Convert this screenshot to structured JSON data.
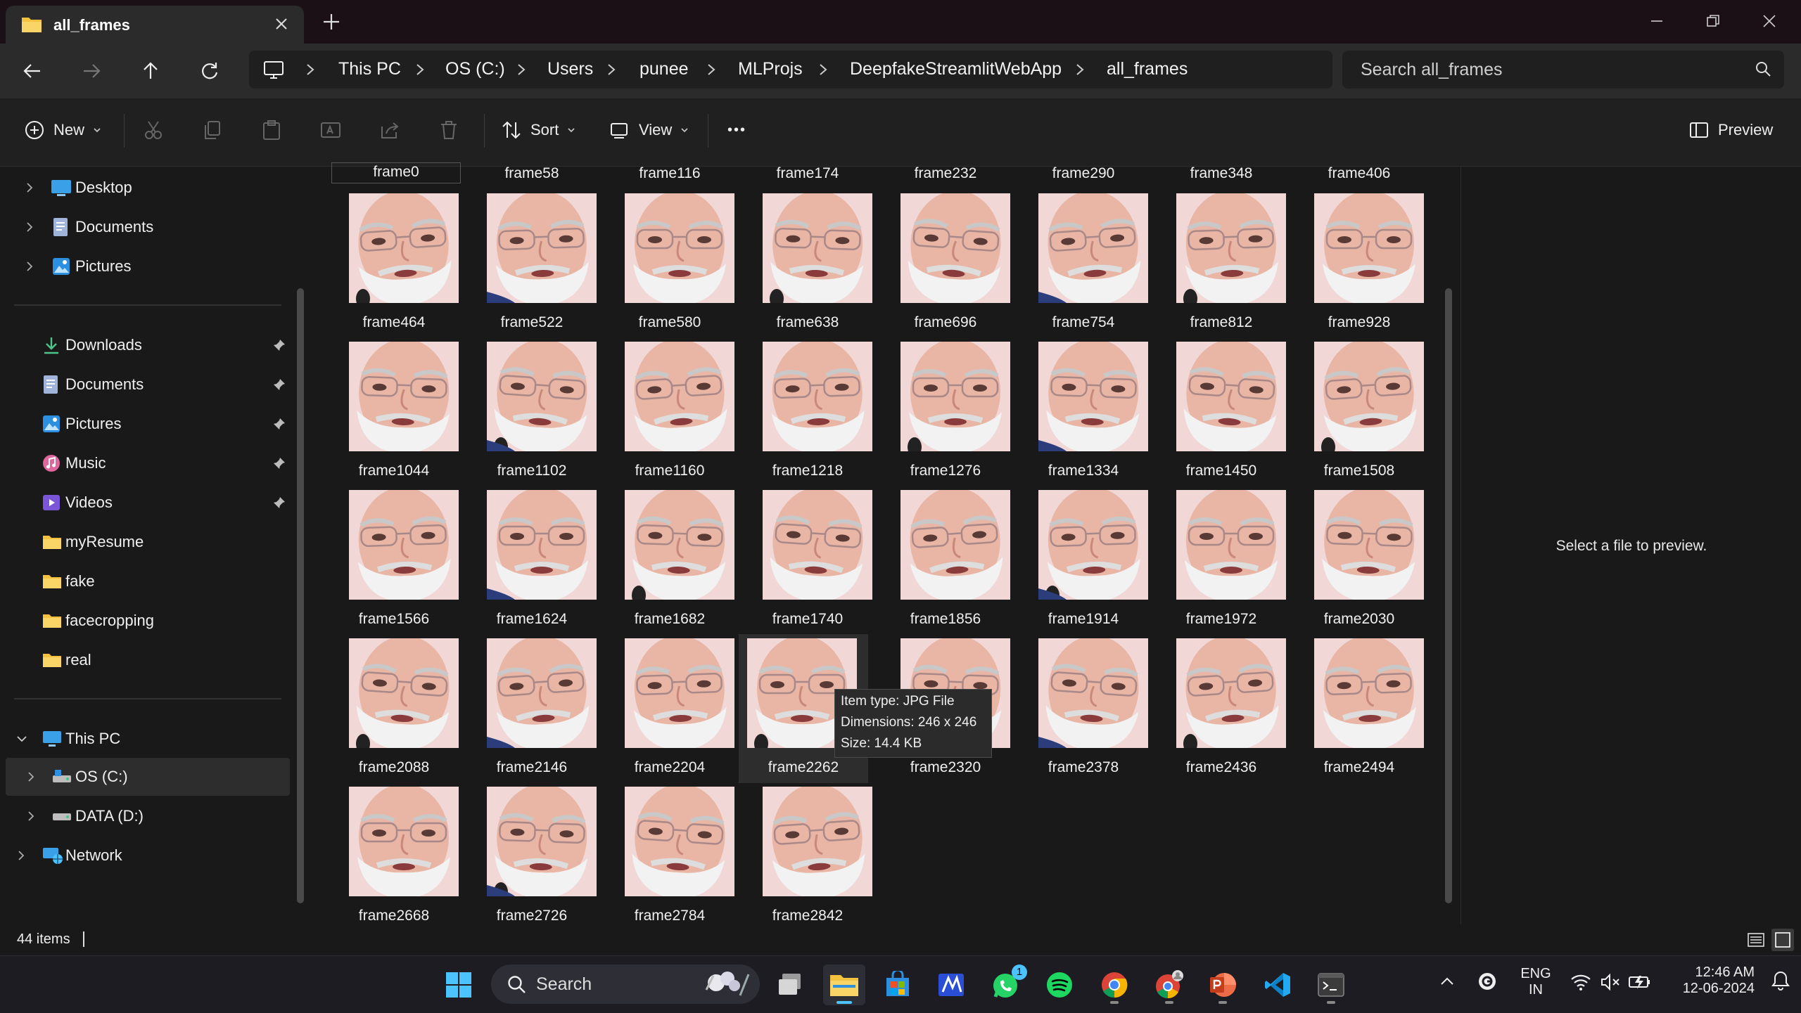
{
  "window": {
    "tab_title": "all_frames",
    "controls": [
      "minimize",
      "restore",
      "close"
    ]
  },
  "address": {
    "crumbs": [
      "This PC",
      "OS (C:)",
      "Users",
      "punee",
      "MLProjs",
      "DeepfakeStreamlitWebApp",
      "all_frames"
    ],
    "search_placeholder": "Search all_frames"
  },
  "toolbar": {
    "new_label": "New",
    "sort_label": "Sort",
    "view_label": "View",
    "more_label": "•••",
    "preview_label": "Preview"
  },
  "sidebar": {
    "top_items": [
      {
        "label": "Desktop",
        "icon": "desktop-icon"
      },
      {
        "label": "Documents",
        "icon": "documents-icon"
      },
      {
        "label": "Pictures",
        "icon": "pictures-icon"
      }
    ],
    "quick_access": [
      {
        "label": "Downloads",
        "icon": "downloads-icon",
        "pinned": true
      },
      {
        "label": "Documents",
        "icon": "documents-icon",
        "pinned": true
      },
      {
        "label": "Pictures",
        "icon": "pictures-icon",
        "pinned": true
      },
      {
        "label": "Music",
        "icon": "music-icon",
        "pinned": true
      },
      {
        "label": "Videos",
        "icon": "videos-icon",
        "pinned": true
      },
      {
        "label": "myResume",
        "icon": "folder-icon",
        "pinned": false
      },
      {
        "label": "fake",
        "icon": "folder-icon",
        "pinned": false
      },
      {
        "label": "facecropping",
        "icon": "folder-icon",
        "pinned": false
      },
      {
        "label": "real",
        "icon": "folder-icon",
        "pinned": false
      }
    ],
    "this_pc": {
      "label": "This PC",
      "icon": "this-pc-icon"
    },
    "drives": [
      {
        "label": "OS (C:)",
        "icon": "drive-c-icon"
      },
      {
        "label": "DATA (D:)",
        "icon": "drive-icon"
      }
    ],
    "network": {
      "label": "Network",
      "icon": "network-icon"
    }
  },
  "files": {
    "top_row": [
      "frame0",
      "frame58",
      "frame116",
      "frame174",
      "frame232",
      "frame290",
      "frame348",
      "frame406"
    ],
    "rows": [
      [
        "frame464",
        "frame522",
        "frame580",
        "frame638",
        "frame696",
        "frame754",
        "frame812",
        "frame928"
      ],
      [
        "frame1044",
        "frame1102",
        "frame1160",
        "frame1218",
        "frame1276",
        "frame1334",
        "frame1450",
        "frame1508"
      ],
      [
        "frame1566",
        "frame1624",
        "frame1682",
        "frame1740",
        "frame1856",
        "frame1914",
        "frame1972",
        "frame2030"
      ],
      [
        "frame2088",
        "frame2146",
        "frame2204",
        "frame2262",
        "frame2320",
        "frame2378",
        "frame2436",
        "frame2494"
      ],
      [
        "frame2668",
        "frame2726",
        "frame2784",
        "frame2842"
      ]
    ],
    "hovered": "frame2262"
  },
  "tooltip": {
    "type": "Item type: JPG File",
    "dimensions": "Dimensions: 246 x 246",
    "size": "Size: 14.4 KB"
  },
  "preview": {
    "message": "Select a file to preview."
  },
  "status": {
    "count": "44 items"
  },
  "taskbar": {
    "search_label": "Search",
    "apps": [
      "start-icon",
      "task-view-icon",
      "file-explorer-icon",
      "microsoft-store-icon",
      "mathpix-icon",
      "whatsapp-icon",
      "spotify-icon",
      "chrome-icon",
      "chrome-profile-icon",
      "powerpoint-icon",
      "vscode-icon",
      "terminal-icon"
    ],
    "whatsapp_badge": "1",
    "language": "ENG",
    "region": "IN",
    "time": "12:46 AM",
    "date": "12-06-2024"
  },
  "colors": {
    "skin": "#e9b6a5",
    "background_pink": "#f1d7d6",
    "accent": "#4cc2ff",
    "folder": "#f3c23e"
  }
}
